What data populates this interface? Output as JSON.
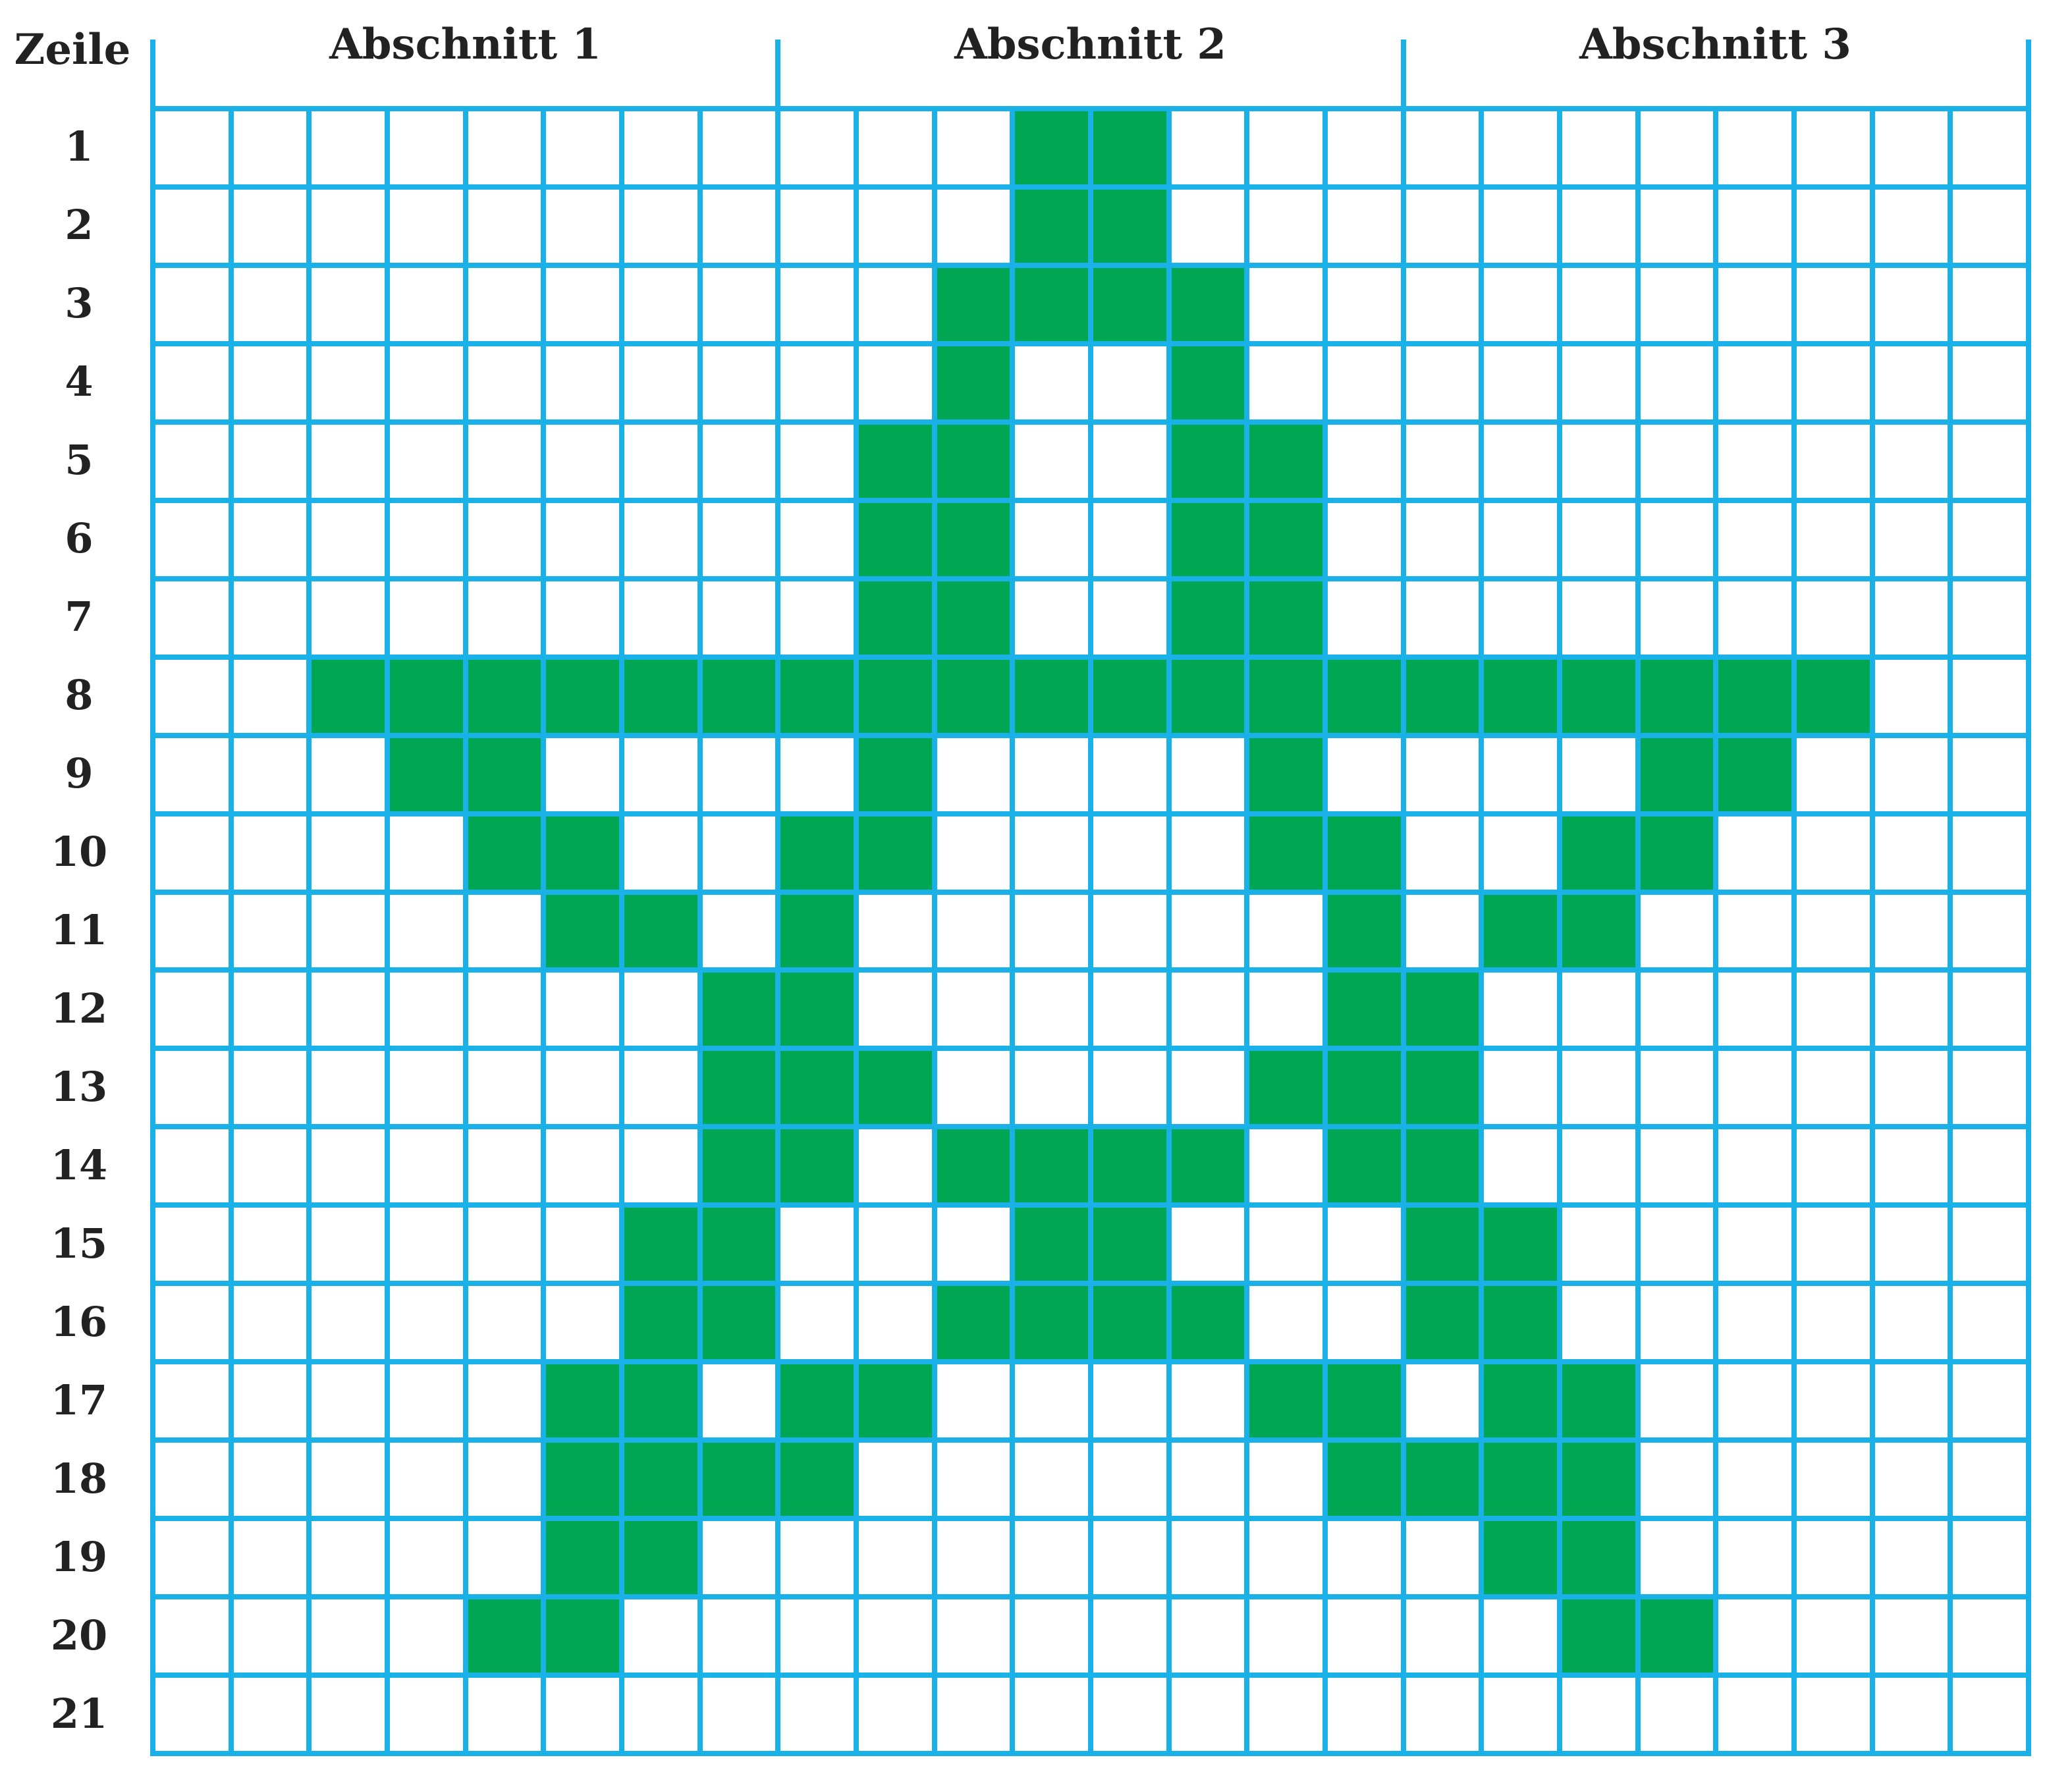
{
  "header": {
    "row_label": "Zeile",
    "sections": [
      "Abschnitt 1",
      "Abschnitt 2",
      "Abschnitt 3"
    ]
  },
  "grid": {
    "columns": 24,
    "columns_per_section": 8,
    "rows": [
      "1",
      "2",
      "3",
      "4",
      "5",
      "6",
      "7",
      "8",
      "9",
      "10",
      "11",
      "12",
      "13",
      "14",
      "15",
      "16",
      "17",
      "18",
      "19",
      "20",
      "21"
    ],
    "fill_color": "#00a651",
    "line_color": "#1ab0e8",
    "filled_columns_by_row": [
      [
        12,
        13
      ],
      [
        12,
        13
      ],
      [
        11,
        12,
        13,
        14
      ],
      [
        11,
        14
      ],
      [
        10,
        11,
        14,
        15
      ],
      [
        10,
        11,
        14,
        15
      ],
      [
        10,
        11,
        14,
        15
      ],
      [
        3,
        4,
        5,
        6,
        7,
        8,
        9,
        10,
        11,
        12,
        13,
        14,
        15,
        16,
        17,
        18,
        19,
        20,
        21,
        22
      ],
      [
        4,
        5,
        10,
        15,
        20,
        21
      ],
      [
        5,
        6,
        9,
        10,
        15,
        16,
        19,
        20
      ],
      [
        6,
        7,
        9,
        16,
        18,
        19
      ],
      [
        8,
        9,
        16,
        17
      ],
      [
        8,
        9,
        10,
        15,
        16,
        17
      ],
      [
        8,
        9,
        11,
        12,
        13,
        14,
        16,
        17
      ],
      [
        7,
        8,
        12,
        13,
        17,
        18
      ],
      [
        7,
        8,
        11,
        12,
        13,
        14,
        17,
        18
      ],
      [
        6,
        7,
        9,
        10,
        15,
        16,
        18,
        19
      ],
      [
        6,
        7,
        8,
        9,
        16,
        17,
        18,
        19
      ],
      [
        6,
        7,
        18,
        19
      ],
      [
        5,
        6,
        19,
        20
      ],
      []
    ]
  }
}
